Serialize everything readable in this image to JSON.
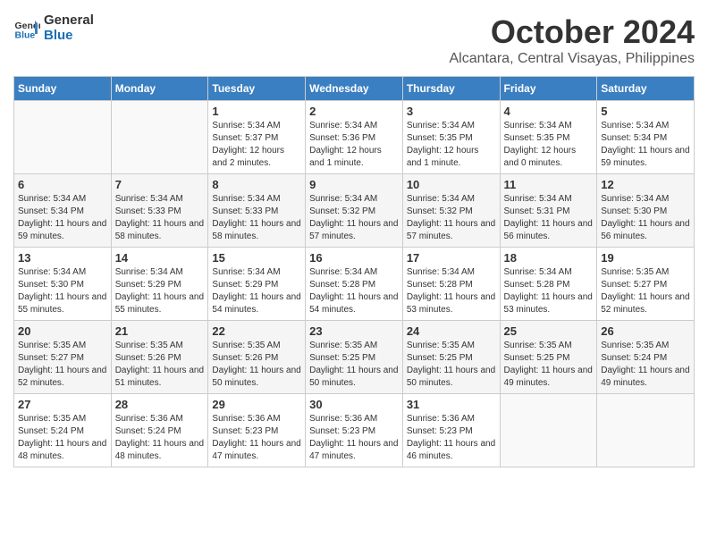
{
  "header": {
    "logo_line1": "General",
    "logo_line2": "Blue",
    "month": "October 2024",
    "location": "Alcantara, Central Visayas, Philippines"
  },
  "weekdays": [
    "Sunday",
    "Monday",
    "Tuesday",
    "Wednesday",
    "Thursday",
    "Friday",
    "Saturday"
  ],
  "weeks": [
    [
      {
        "day": "",
        "sunrise": "",
        "sunset": "",
        "daylight": ""
      },
      {
        "day": "",
        "sunrise": "",
        "sunset": "",
        "daylight": ""
      },
      {
        "day": "1",
        "sunrise": "Sunrise: 5:34 AM",
        "sunset": "Sunset: 5:37 PM",
        "daylight": "Daylight: 12 hours and 2 minutes."
      },
      {
        "day": "2",
        "sunrise": "Sunrise: 5:34 AM",
        "sunset": "Sunset: 5:36 PM",
        "daylight": "Daylight: 12 hours and 1 minute."
      },
      {
        "day": "3",
        "sunrise": "Sunrise: 5:34 AM",
        "sunset": "Sunset: 5:35 PM",
        "daylight": "Daylight: 12 hours and 1 minute."
      },
      {
        "day": "4",
        "sunrise": "Sunrise: 5:34 AM",
        "sunset": "Sunset: 5:35 PM",
        "daylight": "Daylight: 12 hours and 0 minutes."
      },
      {
        "day": "5",
        "sunrise": "Sunrise: 5:34 AM",
        "sunset": "Sunset: 5:34 PM",
        "daylight": "Daylight: 11 hours and 59 minutes."
      }
    ],
    [
      {
        "day": "6",
        "sunrise": "Sunrise: 5:34 AM",
        "sunset": "Sunset: 5:34 PM",
        "daylight": "Daylight: 11 hours and 59 minutes."
      },
      {
        "day": "7",
        "sunrise": "Sunrise: 5:34 AM",
        "sunset": "Sunset: 5:33 PM",
        "daylight": "Daylight: 11 hours and 58 minutes."
      },
      {
        "day": "8",
        "sunrise": "Sunrise: 5:34 AM",
        "sunset": "Sunset: 5:33 PM",
        "daylight": "Daylight: 11 hours and 58 minutes."
      },
      {
        "day": "9",
        "sunrise": "Sunrise: 5:34 AM",
        "sunset": "Sunset: 5:32 PM",
        "daylight": "Daylight: 11 hours and 57 minutes."
      },
      {
        "day": "10",
        "sunrise": "Sunrise: 5:34 AM",
        "sunset": "Sunset: 5:32 PM",
        "daylight": "Daylight: 11 hours and 57 minutes."
      },
      {
        "day": "11",
        "sunrise": "Sunrise: 5:34 AM",
        "sunset": "Sunset: 5:31 PM",
        "daylight": "Daylight: 11 hours and 56 minutes."
      },
      {
        "day": "12",
        "sunrise": "Sunrise: 5:34 AM",
        "sunset": "Sunset: 5:30 PM",
        "daylight": "Daylight: 11 hours and 56 minutes."
      }
    ],
    [
      {
        "day": "13",
        "sunrise": "Sunrise: 5:34 AM",
        "sunset": "Sunset: 5:30 PM",
        "daylight": "Daylight: 11 hours and 55 minutes."
      },
      {
        "day": "14",
        "sunrise": "Sunrise: 5:34 AM",
        "sunset": "Sunset: 5:29 PM",
        "daylight": "Daylight: 11 hours and 55 minutes."
      },
      {
        "day": "15",
        "sunrise": "Sunrise: 5:34 AM",
        "sunset": "Sunset: 5:29 PM",
        "daylight": "Daylight: 11 hours and 54 minutes."
      },
      {
        "day": "16",
        "sunrise": "Sunrise: 5:34 AM",
        "sunset": "Sunset: 5:28 PM",
        "daylight": "Daylight: 11 hours and 54 minutes."
      },
      {
        "day": "17",
        "sunrise": "Sunrise: 5:34 AM",
        "sunset": "Sunset: 5:28 PM",
        "daylight": "Daylight: 11 hours and 53 minutes."
      },
      {
        "day": "18",
        "sunrise": "Sunrise: 5:34 AM",
        "sunset": "Sunset: 5:28 PM",
        "daylight": "Daylight: 11 hours and 53 minutes."
      },
      {
        "day": "19",
        "sunrise": "Sunrise: 5:35 AM",
        "sunset": "Sunset: 5:27 PM",
        "daylight": "Daylight: 11 hours and 52 minutes."
      }
    ],
    [
      {
        "day": "20",
        "sunrise": "Sunrise: 5:35 AM",
        "sunset": "Sunset: 5:27 PM",
        "daylight": "Daylight: 11 hours and 52 minutes."
      },
      {
        "day": "21",
        "sunrise": "Sunrise: 5:35 AM",
        "sunset": "Sunset: 5:26 PM",
        "daylight": "Daylight: 11 hours and 51 minutes."
      },
      {
        "day": "22",
        "sunrise": "Sunrise: 5:35 AM",
        "sunset": "Sunset: 5:26 PM",
        "daylight": "Daylight: 11 hours and 50 minutes."
      },
      {
        "day": "23",
        "sunrise": "Sunrise: 5:35 AM",
        "sunset": "Sunset: 5:25 PM",
        "daylight": "Daylight: 11 hours and 50 minutes."
      },
      {
        "day": "24",
        "sunrise": "Sunrise: 5:35 AM",
        "sunset": "Sunset: 5:25 PM",
        "daylight": "Daylight: 11 hours and 50 minutes."
      },
      {
        "day": "25",
        "sunrise": "Sunrise: 5:35 AM",
        "sunset": "Sunset: 5:25 PM",
        "daylight": "Daylight: 11 hours and 49 minutes."
      },
      {
        "day": "26",
        "sunrise": "Sunrise: 5:35 AM",
        "sunset": "Sunset: 5:24 PM",
        "daylight": "Daylight: 11 hours and 49 minutes."
      }
    ],
    [
      {
        "day": "27",
        "sunrise": "Sunrise: 5:35 AM",
        "sunset": "Sunset: 5:24 PM",
        "daylight": "Daylight: 11 hours and 48 minutes."
      },
      {
        "day": "28",
        "sunrise": "Sunrise: 5:36 AM",
        "sunset": "Sunset: 5:24 PM",
        "daylight": "Daylight: 11 hours and 48 minutes."
      },
      {
        "day": "29",
        "sunrise": "Sunrise: 5:36 AM",
        "sunset": "Sunset: 5:23 PM",
        "daylight": "Daylight: 11 hours and 47 minutes."
      },
      {
        "day": "30",
        "sunrise": "Sunrise: 5:36 AM",
        "sunset": "Sunset: 5:23 PM",
        "daylight": "Daylight: 11 hours and 47 minutes."
      },
      {
        "day": "31",
        "sunrise": "Sunrise: 5:36 AM",
        "sunset": "Sunset: 5:23 PM",
        "daylight": "Daylight: 11 hours and 46 minutes."
      },
      {
        "day": "",
        "sunrise": "",
        "sunset": "",
        "daylight": ""
      },
      {
        "day": "",
        "sunrise": "",
        "sunset": "",
        "daylight": ""
      }
    ]
  ]
}
